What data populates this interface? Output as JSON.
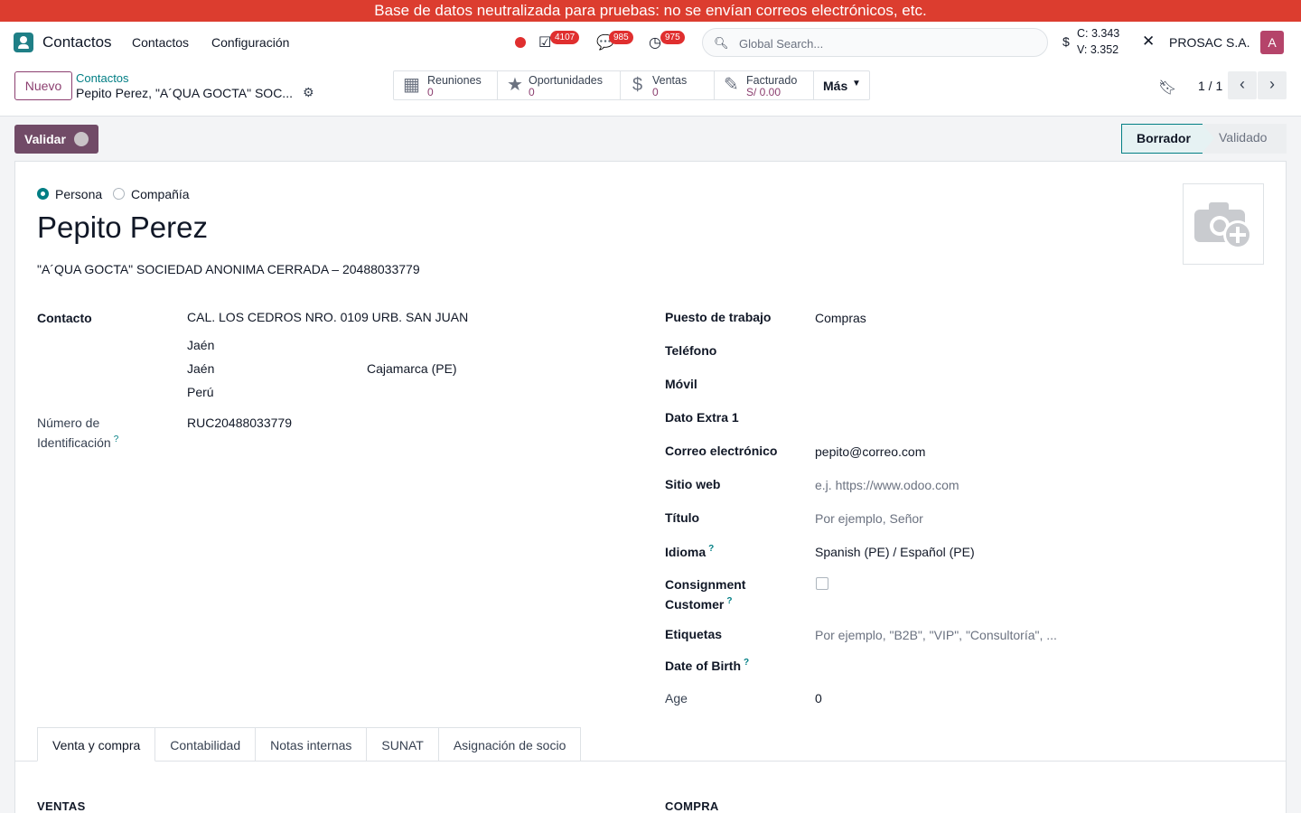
{
  "banner": "Base de datos neutralizada para pruebas: no se envían correos electrónicos, etc.",
  "navbar": {
    "app_name": "Contactos",
    "menus": [
      "Contactos",
      "Configuración"
    ],
    "counters": {
      "activities": "4107",
      "messages": "985",
      "timesheets": "975"
    },
    "search_placeholder": "Global Search...",
    "currency_symbol": "$",
    "rate_buy": "C: 3.343",
    "rate_sell": "V: 3.352",
    "company": "PROSAC S.A.",
    "avatar_letter": "A"
  },
  "control": {
    "new_label": "Nuevo",
    "breadcrumb_parent": "Contactos",
    "breadcrumb_current": "Pepito Perez, \"A´QUA GOCTA\" SOC...",
    "smart_buttons": [
      {
        "label": "Reuniones",
        "value": "0",
        "icon": "calendar-icon"
      },
      {
        "label": "Oportunidades",
        "value": "0",
        "icon": "star-icon"
      },
      {
        "label": "Ventas",
        "value": "0",
        "icon": "dollar-icon"
      },
      {
        "label": "Facturado",
        "value": "S/ 0.00",
        "icon": "edit-icon"
      }
    ],
    "more_label": "Más",
    "pager": "1 / 1"
  },
  "statusbar": {
    "validate_label": "Validar",
    "stages": [
      "Borrador",
      "Validado"
    ],
    "active_stage": "Borrador"
  },
  "form": {
    "type_options": [
      "Persona",
      "Compañía"
    ],
    "type_selected": "Persona",
    "name": "Pepito Perez",
    "parent": "\"A´QUA GOCTA\" SOCIEDAD ANONIMA CERRADA – 20488033779",
    "left": {
      "contact_label": "Contacto",
      "street": "CAL. LOS CEDROS NRO. 0109 URB. SAN JUAN",
      "district": "Jaén",
      "city": "Jaén",
      "state": "Cajamarca (PE)",
      "country": "Perú",
      "id_label_line1": "Número de",
      "id_label_line2": "Identificación",
      "id_value": "RUC20488033779"
    },
    "right": {
      "job_label": "Puesto de trabajo",
      "job_value": "Compras",
      "phone_label": "Teléfono",
      "mobile_label": "Móvil",
      "extra_label": "Dato Extra 1",
      "email_label": "Correo electrónico",
      "email_value": "pepito@correo.com",
      "website_label": "Sitio web",
      "website_placeholder": "e.j. https://www.odoo.com",
      "title_label": "Título",
      "title_placeholder": "Por ejemplo, Señor",
      "lang_label": "Idioma",
      "lang_value": "Spanish (PE) / Español (PE)",
      "consign_label_line1": "Consignment",
      "consign_label_line2": "Customer",
      "tags_label": "Etiquetas",
      "tags_placeholder": "Por ejemplo, \"B2B\", \"VIP\", \"Consultoría\", ...",
      "birth_label": "Date of Birth",
      "age_label": "Age",
      "age_value": "0"
    },
    "tabs": [
      "Venta y compra",
      "Contabilidad",
      "Notas internas",
      "SUNAT",
      "Asignación de socio"
    ],
    "section_sales": "VENTAS",
    "section_purchase": "COMPRA"
  }
}
